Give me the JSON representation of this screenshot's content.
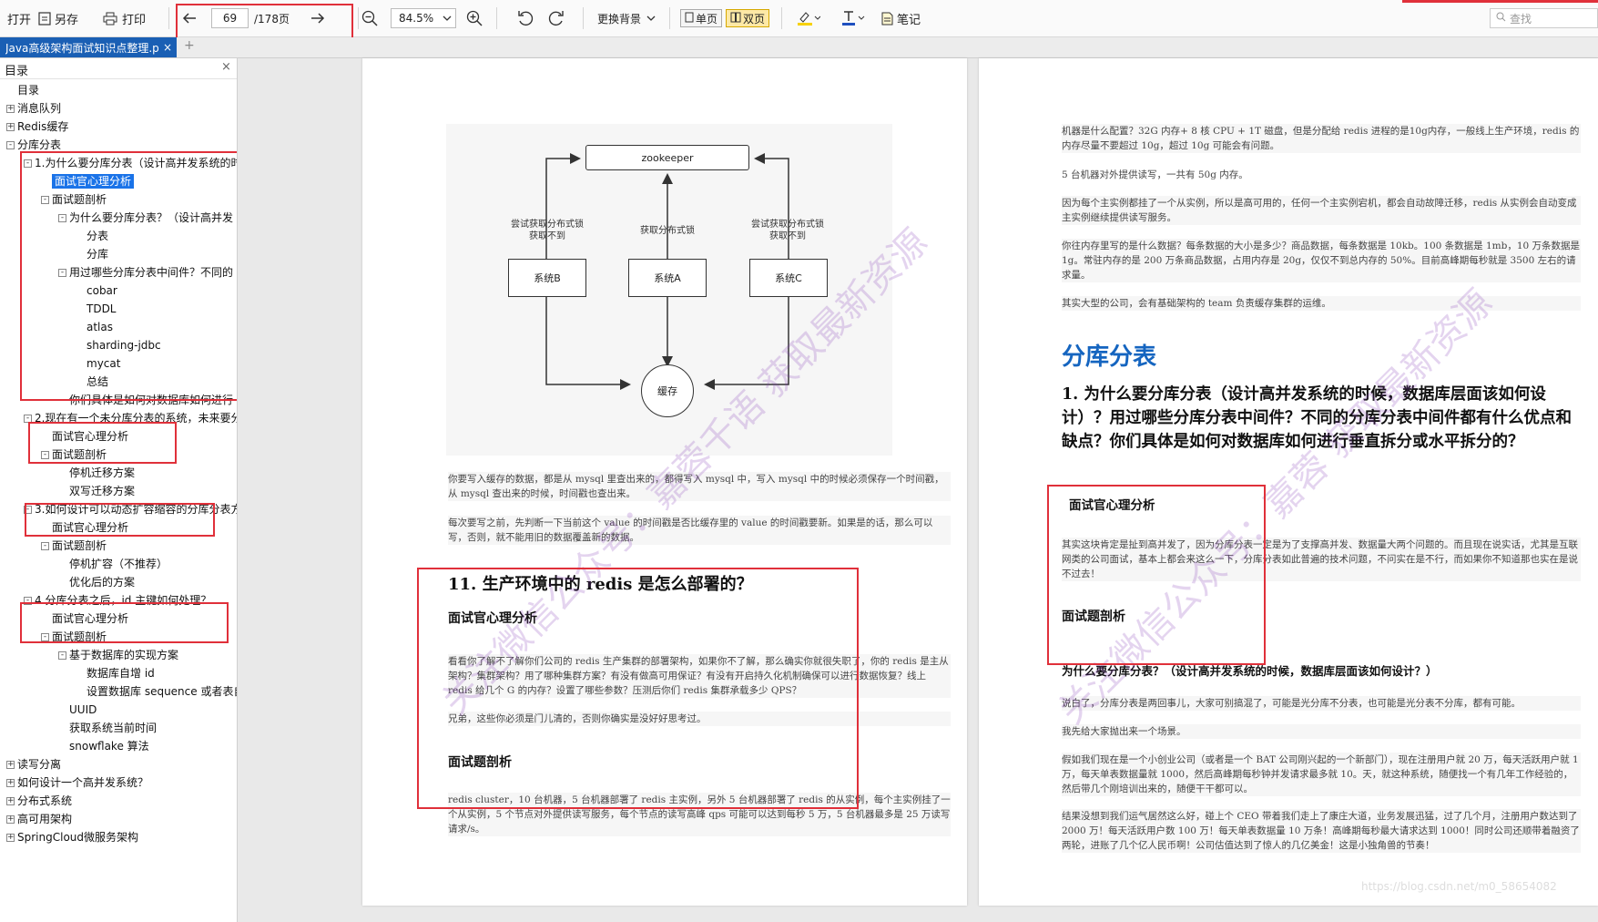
{
  "toolbar": {
    "open": "打开",
    "save_as": "另存",
    "print": "打印",
    "page_current": "69",
    "page_total": "/178页",
    "zoom": "84.5%",
    "background": "更换背景",
    "single_page": "单页",
    "double_page": "双页",
    "notes": "笔记",
    "search_placeholder": "查找"
  },
  "tab": {
    "title": "Java高级架构面试知识点整理.p",
    "close": "×",
    "add": "+"
  },
  "sidebar": {
    "title": "目录",
    "close": "×",
    "items": [
      {
        "label": "目录"
      },
      {
        "label": "消息队列"
      },
      {
        "label": "Redis缓存"
      },
      {
        "label": "分库分表"
      },
      {
        "label": "1.为什么要分库分表（设计高并发系统的时"
      },
      {
        "label": "面试官心理分析"
      },
      {
        "label": "面试题剖析"
      },
      {
        "label": "为什么要分库分表？（设计高并发"
      },
      {
        "label": "分表"
      },
      {
        "label": "分库"
      },
      {
        "label": "用过哪些分库分表中间件？不同的"
      },
      {
        "label": "cobar"
      },
      {
        "label": "TDDL"
      },
      {
        "label": "atlas"
      },
      {
        "label": "sharding-jdbc"
      },
      {
        "label": "mycat"
      },
      {
        "label": "总结"
      },
      {
        "label": "你们具体是如何对数据库如何进行"
      },
      {
        "label": "2.现在有一个未分库分表的系统，未来要分"
      },
      {
        "label": "面试官心理分析"
      },
      {
        "label": "面试题剖析"
      },
      {
        "label": "停机迁移方案"
      },
      {
        "label": "双写迁移方案"
      },
      {
        "label": "3.如何设计可以动态扩容缩容的分库分表方"
      },
      {
        "label": "面试官心理分析"
      },
      {
        "label": "面试题剖析"
      },
      {
        "label": "停机扩容（不推荐）"
      },
      {
        "label": "优化后的方案"
      },
      {
        "label": "4.分库分表之后，id 主键如何处理？"
      },
      {
        "label": "面试官心理分析"
      },
      {
        "label": "面试题剖析"
      },
      {
        "label": "基于数据库的实现方案"
      },
      {
        "label": "数据库自增 id"
      },
      {
        "label": "设置数据库 sequence 或者表自"
      },
      {
        "label": "UUID"
      },
      {
        "label": "获取系统当前时间"
      },
      {
        "label": "snowflake 算法"
      },
      {
        "label": "读写分离"
      },
      {
        "label": "如何设计一个高并发系统？"
      },
      {
        "label": "分布式系统"
      },
      {
        "label": "高可用架构"
      },
      {
        "label": "SpringCloud微服务架构"
      }
    ]
  },
  "left_page": {
    "diagram": {
      "zookeeper": "zookeeper",
      "sys_b": "系统B",
      "sys_a": "系统A",
      "sys_c": "系统C",
      "cache": "缓存",
      "label_left": "尝试获取分布式锁\n获取不到",
      "label_mid": "获取分布式锁",
      "label_right": "尝试获取分布式锁\n获取不到"
    },
    "para1": "你要写入缓存的数据，都是从 mysql 里查出来的，都得写入 mysql 中，写入 mysql 中的时候必须保存一个时间戳，从 mysql 查出来的时候，时间戳也查出来。",
    "para2": "每次要写之前，先判断一下当前这个 value 的时间戳是否比缓存里的 value 的时间戳要新。如果是的话，那么可以写，否则，就不能用旧的数据覆盖新的数据。",
    "heading": "11. 生产环境中的 redis 是怎么部署的？",
    "sub1": "面试官心理分析",
    "para3": "看看你了解不了解你们公司的 redis 生产集群的部署架构，如果你不了解，那么确实你就很失职了，你的 redis 是主从架构？集群架构？用了哪种集群方案？有没有做高可用保证？有没有开启持久化机制确保可以进行数据恢复？线上 redis 给几个 G 的内存？设置了哪些参数？压测后你们 redis 集群承载多少 QPS？",
    "para4": "兄弟，这些你必须是门儿清的，否则你确实是没好好思考过。",
    "sub2": "面试题剖析",
    "para5": "redis cluster，10 台机器，5 台机器部署了 redis 主实例，另外 5 台机器部署了 redis 的从实例，每个主实例挂了一个从实例，5 个节点对外提供读写服务，每个节点的读写高峰 qps 可能可以达到每秒 5 万，5 台机器最多是 25 万读写请求/s。"
  },
  "right_page": {
    "para1": "机器是什么配置？32G 内存+ 8 核 CPU + 1T 磁盘，但是分配给 redis 进程的是10g内存，一般线上生产环境，redis 的内存尽量不要超过 10g，超过 10g 可能会有问题。",
    "para2": "5 台机器对外提供读写，一共有 50g 内存。",
    "para3": "因为每个主实例都挂了一个从实例，所以是高可用的，任何一个主实例宕机，都会自动故障迁移，redis 从实例会自动变成主实例继续提供读写服务。",
    "para4": "你往内存里写的是什么数据？每条数据的大小是多少？商品数据，每条数据是 10kb。100 条数据是 1mb，10 万条数据是 1g。常驻内存的是 200 万条商品数据，占用内存是 20g，仅仅不到总内存的 50%。目前高峰期每秒就是 3500 左右的请求量。",
    "para5": "其实大型的公司，会有基础架构的 team 负责缓存集群的运维。",
    "section_title": "分库分表",
    "heading": "1. 为什么要分库分表（设计高并发系统的时候，数据库层面该如何设计）？用过哪些分库分表中间件？不同的分库分表中间件都有什么优点和缺点？你们具体是如何对数据库如何进行垂直拆分或水平拆分的？",
    "sub1": "面试官心理分析",
    "para6": "其实这块肯定是扯到高并发了，因为分库分表一定是为了支撑高并发、数据量大两个问题的。而且现在说实话，尤其是互联网类的公司面试，基本上都会来这么一下，分库分表如此普遍的技术问题，不问实在是不行，而如果你不知道那也实在是说不过去！",
    "sub2": "面试题剖析",
    "sub3": "为什么要分库分表？（设计高并发系统的时候，数据库层面该如何设计？）",
    "para7": "说白了，分库分表是两回事儿，大家可别搞混了，可能是光分库不分表，也可能是光分表不分库，都有可能。",
    "para8": "我先给大家抛出来一个场景。",
    "para9": "假如我们现在是一个小创业公司（或者是一个 BAT 公司刚兴起的一个新部门），现在注册用户就 20 万，每天活跃用户就 1 万，每天单表数据量就 1000，然后高峰期每秒钟并发请求最多就 10。天，就这种系统，随便找一个有几年工作经验的，然后带几个刚培训出来的，随便干干都可以。",
    "para10": "结果没想到我们运气居然这么好，碰上个 CEO 带着我们走上了康庄大道，业务发展迅猛，过了几个月，注册用户数达到了 2000 万！每天活跃用户数 100 万！每天单表数据量 10 万条！高峰期每秒最大请求达到 1000！同时公司还顺带着融资了两轮，进账了几个亿人民币啊！公司估值达到了惊人的几亿美金！这是小独角兽的节奏！",
    "footer_url": "https://blog.csdn.net/m0_58654082"
  },
  "watermarks": [
    "关注微信公众号：嘉蓉千语 获取最新资源",
    "关注微信公众号：嘉蓉 获取最新资源"
  ],
  "colors": {
    "accent": "#1a5fb4",
    "highlight_box": "#e0303a",
    "section_title": "#1565c0"
  }
}
